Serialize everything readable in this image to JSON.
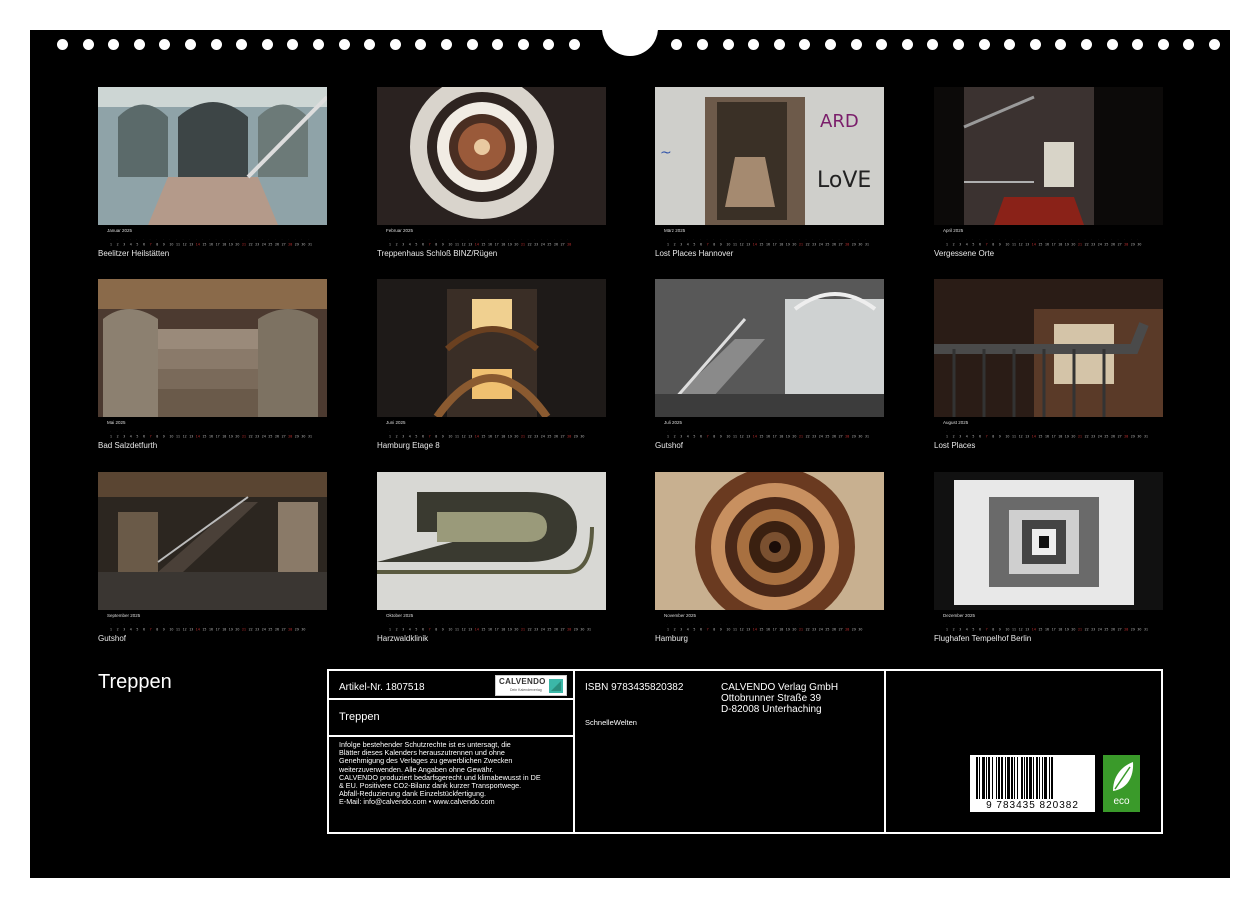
{
  "months": [
    {
      "name": "Januar 2025",
      "caption": "Beelitzer Heilstätten",
      "scene": "arches"
    },
    {
      "name": "Februar 2025",
      "caption": "Treppenhaus Schloß BINZ/Rügen",
      "scene": "spiral-top"
    },
    {
      "name": "März 2025",
      "caption": "Lost Places Hannover",
      "scene": "graffiti"
    },
    {
      "name": "April 2025",
      "caption": "Vergessene Orte",
      "scene": "dark-stair"
    },
    {
      "name": "Mai 2025",
      "caption": "Bad Salzdetfurth",
      "scene": "stone-steps"
    },
    {
      "name": "Juni 2025",
      "caption": "Hamburg Etage 8",
      "scene": "warm-spiral"
    },
    {
      "name": "Juli 2025",
      "caption": "Gutshof",
      "scene": "grey-hall"
    },
    {
      "name": "August 2025",
      "caption": "Lost Places",
      "scene": "railing"
    },
    {
      "name": "September 2025",
      "caption": "Gutshof",
      "scene": "wood-hall"
    },
    {
      "name": "Oktober 2025",
      "caption": "Harzwaldklinik",
      "scene": "curve"
    },
    {
      "name": "November 2025",
      "caption": "Hamburg",
      "scene": "deep-spiral"
    },
    {
      "name": "Dezember 2025",
      "caption": "Flughafen Tempelhof Berlin",
      "scene": "square-spiral"
    }
  ],
  "calendar_title": "Treppen",
  "info": {
    "article": "Artikel-Nr. 1807518",
    "logo_text": "CALVENDO",
    "logo_sub": "Dein Kalenderverlag",
    "product_title": "Treppen",
    "legal_lines": [
      "Infolge bestehender Schutzrechte ist es untersagt, die",
      "Blätter dieses Kalenders herauszutrennen und ohne",
      "Genehmigung des Verlages zu gewerblichen Zwecken",
      "weiterzuverwenden. Alle Angaben ohne Gewähr.",
      "CALVENDO produziert bedarfsgerecht und klimabewusst in DE",
      "& EU. Positivere CO2-Bilanz dank kurzer Transportwege.",
      "Abfall-Reduzierung dank Einzelstückfertigung.",
      "E-Mail: info@calvendo.com • www.calvendo.com"
    ],
    "isbn": "ISBN 9783435820382",
    "author": "SchnelleWelten",
    "publisher_lines": [
      "CALVENDO Verlag GmbH",
      "Ottobrunner Straße 39",
      "D-82008 Unterhaching"
    ],
    "barcode_number": "9 783435 820382",
    "eco_label": "eco"
  },
  "colors": {
    "sheet": "#000000",
    "text": "#ffffff",
    "eco": "#3a9a2a"
  }
}
